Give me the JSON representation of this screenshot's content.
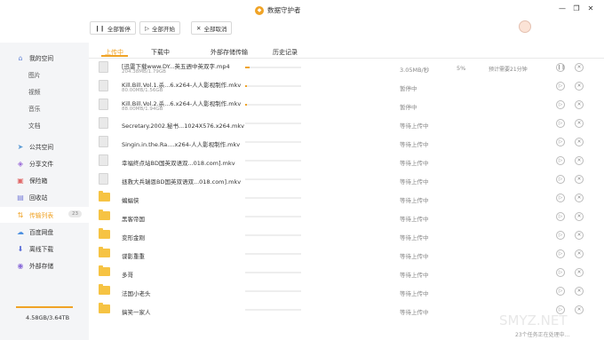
{
  "app": {
    "title": "数据守护者"
  },
  "toolbar": {
    "pause_all": "全部暂停",
    "start_all": "全部开始",
    "cancel_all": "全部取消"
  },
  "sidebar": {
    "items": [
      {
        "label": "我的空间",
        "icon": "home-icon"
      },
      {
        "label": "图片"
      },
      {
        "label": "视频"
      },
      {
        "label": "音乐"
      },
      {
        "label": "文档"
      },
      {
        "label": "公共空间",
        "icon": "send-icon"
      },
      {
        "label": "分享文件",
        "icon": "share-icon"
      },
      {
        "label": "保险箱",
        "icon": "safe-icon"
      },
      {
        "label": "回收站",
        "icon": "trash-icon"
      },
      {
        "label": "传输列表",
        "icon": "transfer-icon",
        "badge": "23"
      },
      {
        "label": "百度网盘",
        "icon": "cloud-icon"
      },
      {
        "label": "离线下载",
        "icon": "download-icon"
      },
      {
        "label": "外部存储",
        "icon": "storage-icon"
      }
    ],
    "storage": "4.58GB/3.64TB"
  },
  "tabs": [
    "上传中",
    "下载中",
    "外部存储传输",
    "历史记录"
  ],
  "files": [
    {
      "name": "[迅雷下载www.DY...英五週中英双字.mp4",
      "size": "204.38MB/1.79GB",
      "type": "file",
      "progress": 0.08,
      "status": "3.05MB/秒",
      "percent": "5%",
      "eta": "预计需要21分钟",
      "action": "pause"
    },
    {
      "name": "Kill.Bill.Vol.1.杀...6.x264-人人影视制作.mkv",
      "size": "80.00MB/1.56GB",
      "type": "file",
      "progress": 0.03,
      "status": "暂停中",
      "action": "play"
    },
    {
      "name": "Kill.Bill.Vol.2.杀...6.x264-人人影视制作.mkv",
      "size": "88.00MB/1.94GB",
      "type": "file",
      "progress": 0.03,
      "status": "暂停中",
      "action": "play"
    },
    {
      "name": "Secretary.2002.秘书...1024X576.x264.mkv",
      "type": "file",
      "progress": 0,
      "status": "等待上传中",
      "action": "play"
    },
    {
      "name": "Singin.in.the.Ra....x264-人人影视制作.mkv",
      "type": "file",
      "progress": 0,
      "status": "等待上传中",
      "action": "play"
    },
    {
      "name": "幸福终点站BD国英双语双...018.com].mkv",
      "type": "file",
      "progress": 0,
      "status": "等待上传中",
      "action": "play"
    },
    {
      "name": "拯救大兵瑞恩BD国英双语双...018.com].mkv",
      "type": "file",
      "progress": 0,
      "status": "等待上传中",
      "action": "play"
    },
    {
      "name": "蝙蝠侠",
      "type": "folder",
      "progress": 0,
      "status": "等待上传中",
      "action": "play"
    },
    {
      "name": "黑客帝国",
      "type": "folder",
      "progress": 0,
      "status": "等待上传中",
      "action": "play"
    },
    {
      "name": "变形金刚",
      "type": "folder",
      "progress": 0,
      "status": "等待上传中",
      "action": "play"
    },
    {
      "name": "谍影重重",
      "type": "folder",
      "progress": 0,
      "status": "等待上传中",
      "action": "play"
    },
    {
      "name": "多哥",
      "type": "folder",
      "progress": 0,
      "status": "等待上传中",
      "action": "play"
    },
    {
      "name": "法国小老头",
      "type": "folder",
      "progress": 0,
      "status": "等待上传中",
      "action": "play"
    },
    {
      "name": "搞笑一家人",
      "type": "folder",
      "progress": 0,
      "status": "等待上传中",
      "action": "play"
    }
  ],
  "footer": {
    "status": "23个任务正在处理中..."
  },
  "watermark": "SMYZ.NET"
}
